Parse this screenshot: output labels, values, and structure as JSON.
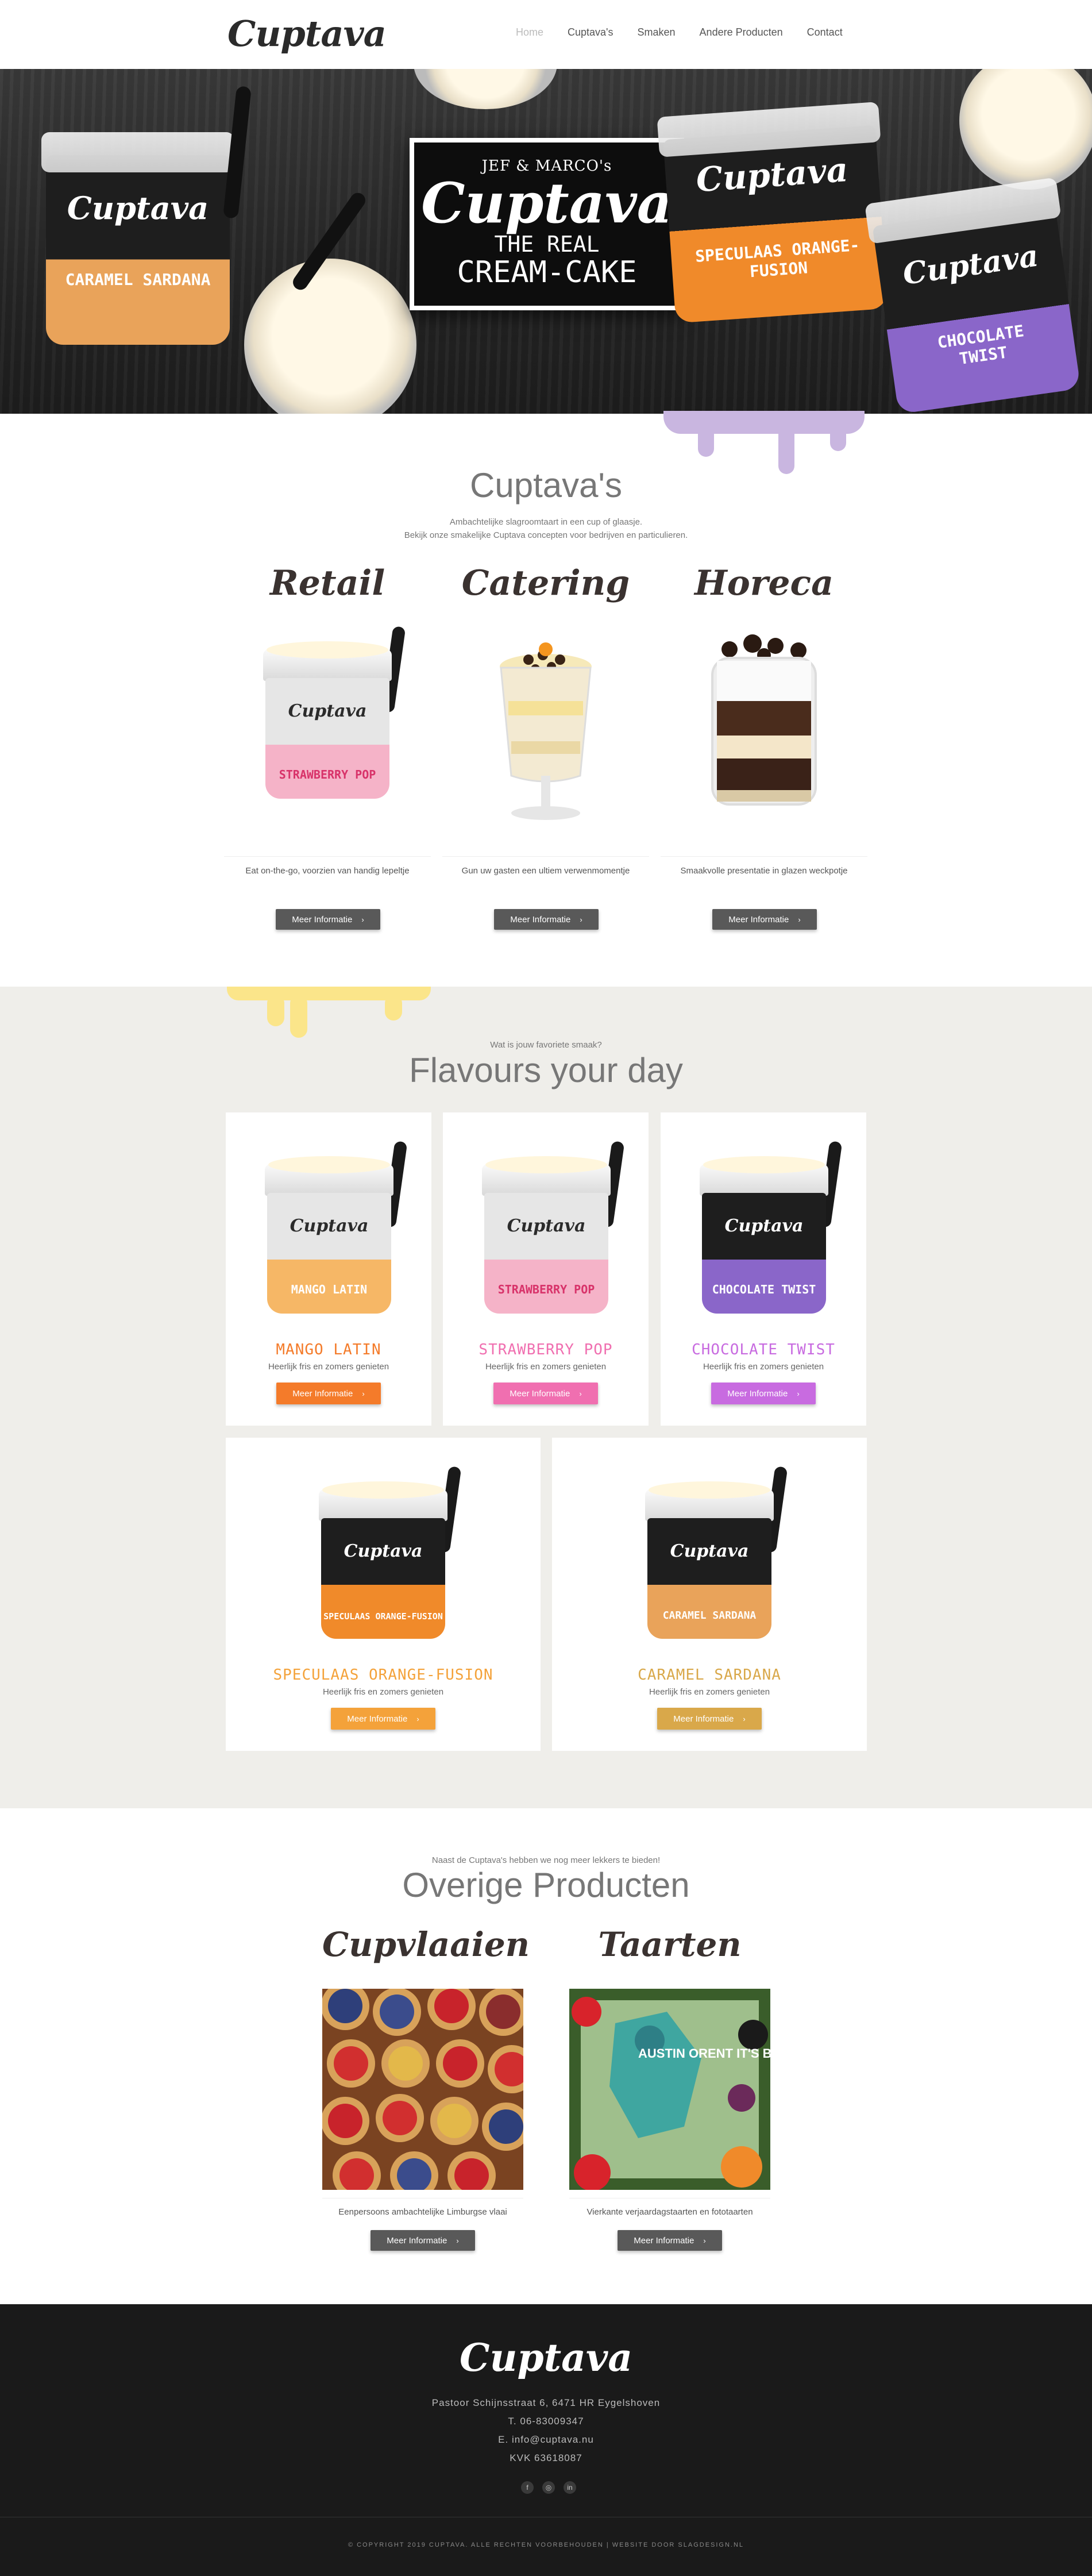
{
  "nav": {
    "logo": "Cuptava",
    "links": [
      "Home",
      "Cuptava's",
      "Smaken",
      "Andere Producten",
      "Contact"
    ]
  },
  "hero": {
    "badge_top": "JEF & MARCO's",
    "badge_brand": "Cuptava",
    "badge_line1": "THE REAL",
    "badge_line2": "CREAM-CAKE",
    "cups": [
      {
        "brand": "Cuptava",
        "flavour": "CARAMEL SARDANA"
      },
      {
        "brand": "Cuptava",
        "flavour": "SPECULAAS ORANGE-FUSION"
      },
      {
        "brand": "Cuptava",
        "flavour": "CHOCOLATE TWIST"
      }
    ]
  },
  "concepts": {
    "title": "Cuptava's",
    "subtitle1": "Ambachtelijke slagroomtaart in een cup of glaasje.",
    "subtitle2": "Bekijk onze smakelijke Cuptava concepten voor bedrijven en particulieren.",
    "items": [
      {
        "name": "Retail",
        "desc": "Eat on-the-go, voorzien van handig lepeltje",
        "button": "Meer Informatie"
      },
      {
        "name": "Catering",
        "desc": "Gun uw gasten een ultiem verwenmomentje",
        "button": "Meer Informatie"
      },
      {
        "name": "Horeca",
        "desc": "Smaakvolle presentatie in glazen weckpotje",
        "button": "Meer Informatie"
      }
    ],
    "retail_cup_flavour": "STRAWBERRY POP"
  },
  "flavours": {
    "eyebrow": "Wat is jouw favoriete smaak?",
    "title": "Flavours your day",
    "items": [
      {
        "name": "MANGO LATIN",
        "sub": "Heerlijk fris en zomers genieten",
        "button": "Meer Informatie",
        "color": "#f47b2a",
        "cup_flavour": "MANGO LATIN"
      },
      {
        "name": "STRAWBERRY POP",
        "sub": "Heerlijk fris en zomers genieten",
        "button": "Meer Informatie",
        "color": "#f06fb0",
        "cup_flavour": "STRAWBERRY POP"
      },
      {
        "name": "CHOCOLATE TWIST",
        "sub": "Heerlijk fris en zomers genieten",
        "button": "Meer Informatie",
        "color": "#c86be0",
        "cup_flavour": "CHOCOLATE TWIST"
      },
      {
        "name": "SPECULAAS ORANGE-FUSION",
        "sub": "Heerlijk fris en zomers genieten",
        "button": "Meer Informatie",
        "color": "#f4a23a",
        "cup_flavour": "SPECULAAS ORANGE-FUSION"
      },
      {
        "name": "CARAMEL SARDANA",
        "sub": "Heerlijk fris en zomers genieten",
        "button": "Meer Informatie",
        "color": "#d9a84a",
        "cup_flavour": "CARAMEL SARDANA"
      }
    ]
  },
  "other": {
    "eyebrow": "Naast de Cuptava's hebben we nog meer lekkers te bieden!",
    "title": "Overige Producten",
    "items": [
      {
        "name": "Cupvlaaien",
        "desc": "Eenpersoons ambachtelijke Limburgse vlaai",
        "button": "Meer Informatie"
      },
      {
        "name": "Taarten",
        "desc": "Vierkante verjaardagstaarten en fototaarten",
        "button": "Meer Informatie"
      }
    ],
    "cake_text": "AUSTIN ORENT IT'S BIRTHDAY LOVE NMMONG GELO"
  },
  "footer": {
    "logo": "Cuptava",
    "address": "Pastoor Schijnsstraat 6, 6471 HR Eygelshoven",
    "phone": "T. 06-83009347",
    "email": "E. info@cuptava.nu",
    "kvk": "KVK 63618087",
    "social": [
      "f",
      "◎",
      "in"
    ],
    "copyright": "© COPYRIGHT 2019 CUPTAVA. ALLE RECHTEN VOORBEHOUDEN  |  WEBSITE DOOR SLAGDESIGN.NL"
  },
  "colors": {
    "dark_button": "#595959",
    "flavour_bg": "#efeeea",
    "footer_bg": "#1a1a1a",
    "drip_yellow": "#fbe58a",
    "drip_purple": "#c9b6e0"
  }
}
